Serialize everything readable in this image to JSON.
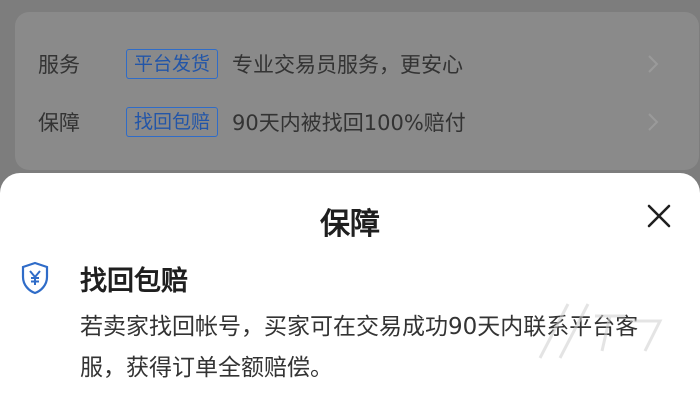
{
  "service_card": {
    "rows": [
      {
        "label": "服务",
        "tag": "平台发货",
        "desc": "专业交易员服务，更安心"
      },
      {
        "label": "保障",
        "tag": "找回包赔",
        "desc": "90天内被找回100%赔付"
      }
    ]
  },
  "sheet": {
    "title": "保障",
    "section": {
      "title": "找回包赔",
      "desc": "若卖家找回帐号，买家可在交易成功90天内联系平台客服，获得订单全额赔偿。"
    }
  },
  "icons": {
    "shield": "shield-yen-icon",
    "close": "close-icon",
    "chevron": "chevron-right-icon"
  },
  "colors": {
    "accent": "#2f6cc8",
    "overlay": "#7d7d7d"
  }
}
